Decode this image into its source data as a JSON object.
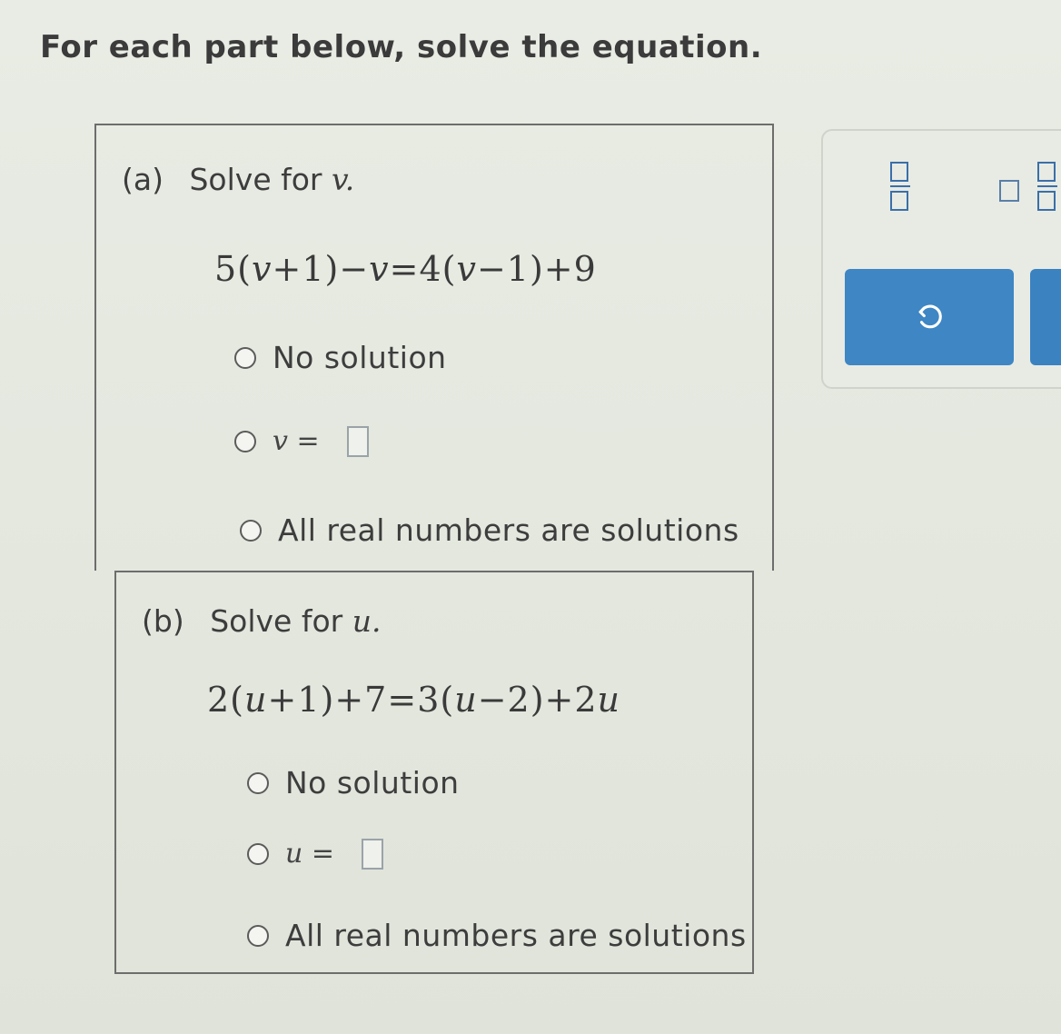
{
  "instructions": "For each part below, solve the equation.",
  "part_a": {
    "label": "(a)",
    "prompt": "Solve for",
    "variable": "v.",
    "equation_parts": [
      "5(",
      "v",
      "+1)−",
      "v",
      "=4(",
      "v",
      "−1)+9"
    ],
    "options": {
      "no_solution": "No solution",
      "var_name": "v",
      "equals": "=",
      "all_real": "All real numbers are solutions"
    }
  },
  "part_b": {
    "label": "(b)",
    "prompt": "Solve for",
    "variable": "u.",
    "equation_parts": [
      "2(",
      "u",
      "+1)",
      "+7=3(",
      "u",
      "−2)+2",
      "u"
    ],
    "options": {
      "no_solution": "No solution",
      "var_name": "u",
      "equals": "=",
      "all_real": "All real numbers are solutions"
    }
  },
  "toolbar": {
    "fraction_icon": "fraction-icon",
    "mixed_number_icon": "mixed-number-icon",
    "undo_icon": "undo-icon",
    "accent_color": "#3e86c4"
  }
}
